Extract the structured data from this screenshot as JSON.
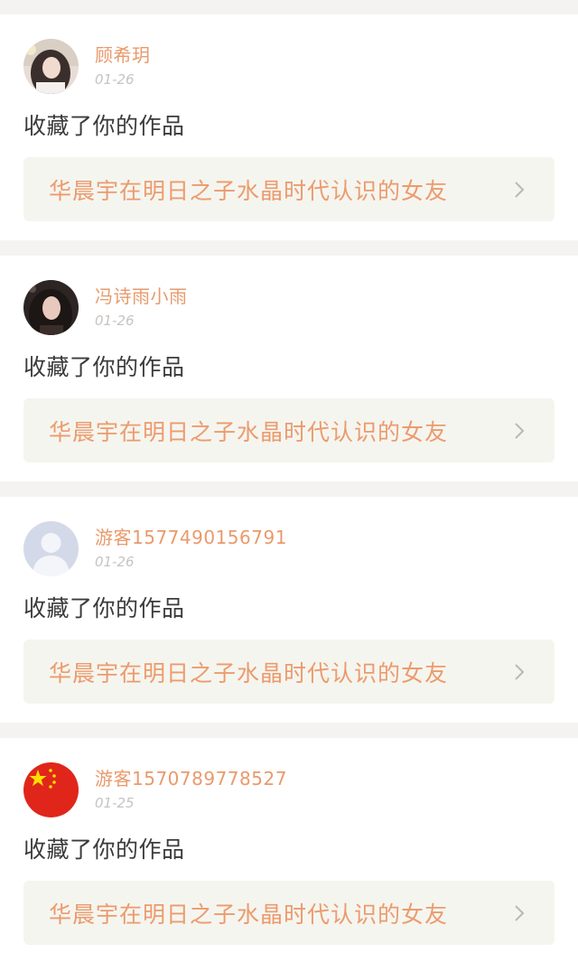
{
  "notifications": [
    {
      "avatar_icon": "girl-photo-avatar-light",
      "username": "顾希玥",
      "date": "01-26",
      "action": "收藏了你的作品",
      "work_title": "华晨宇在明日之子水晶时代认识的女友",
      "chevron_icon": "chevron-right-icon"
    },
    {
      "avatar_icon": "girl-photo-avatar-dark",
      "username": "冯诗雨小雨",
      "date": "01-26",
      "action": "收藏了你的作品",
      "work_title": "华晨宇在明日之子水晶时代认识的女友",
      "chevron_icon": "chevron-right-icon"
    },
    {
      "avatar_icon": "default-user-avatar",
      "username": "游客1577490156791",
      "date": "01-26",
      "action": "收藏了你的作品",
      "work_title": "华晨宇在明日之子水晶时代认识的女友",
      "chevron_icon": "chevron-right-icon"
    },
    {
      "avatar_icon": "china-flag-avatar",
      "username": "游客1570789778527",
      "date": "01-25",
      "action": "收藏了你的作品",
      "work_title": "华晨宇在明日之子水晶时代认识的女友",
      "chevron_icon": "chevron-right-icon"
    }
  ],
  "colors": {
    "accent": "#ec9b6d",
    "page_bg": "#f5f3f1",
    "card_bg": "#ffffff",
    "link_bg": "#f5f5ef",
    "date": "#c7c4c1",
    "text": "#3b3b3b"
  }
}
